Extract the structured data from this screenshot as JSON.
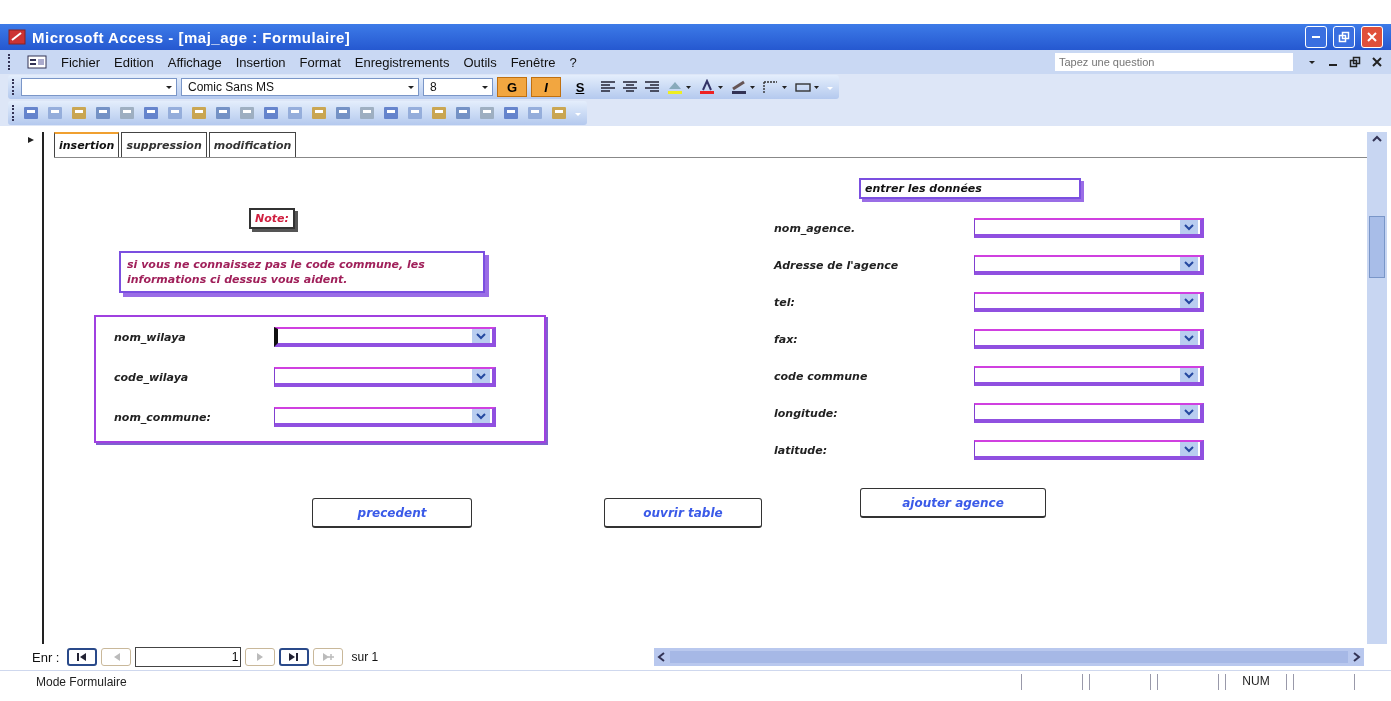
{
  "window": {
    "title": "Microsoft Access - [maj_age : Formulaire]"
  },
  "menu": [
    "Fichier",
    "Edition",
    "Affichage",
    "Insertion",
    "Format",
    "Enregistrements",
    "Outils",
    "Fenêtre",
    "?"
  ],
  "help_box": {
    "placeholder": "Tapez une question"
  },
  "format_toolbar": {
    "font": "Comic Sans MS",
    "size": "8",
    "style_buttons": [
      {
        "label": "G",
        "on": true
      },
      {
        "label": "I",
        "on": true
      },
      {
        "label": "S",
        "on": false
      }
    ]
  },
  "tabs": [
    {
      "label": "insertion",
      "selected": true
    },
    {
      "label": "suppression",
      "selected": false
    },
    {
      "label": "modification",
      "selected": false
    }
  ],
  "note": {
    "title": "Note:",
    "text": "si vous ne connaissez pas le code commune, les informations ci dessus vous aident."
  },
  "wilaya_fields": [
    {
      "label": "nom_wilaya",
      "focused": true
    },
    {
      "label": "code_wilaya",
      "focused": false
    },
    {
      "label": "nom_commune:",
      "focused": false
    }
  ],
  "section_title": "entrer les données",
  "agence_fields": [
    {
      "label": "nom_agence."
    },
    {
      "label": "Adresse de l'agence"
    },
    {
      "label": "tel:"
    },
    {
      "label": "fax:"
    },
    {
      "label": "code commune"
    },
    {
      "label": "longitude:"
    },
    {
      "label": "latitude:"
    }
  ],
  "buttons": [
    "precedent",
    "ouvrir table",
    "ajouter agence"
  ],
  "record_nav": {
    "label": "Enr :",
    "current": "1",
    "total": "sur 1",
    "buttons": [
      {
        "kind": "first",
        "disabled": false
      },
      {
        "kind": "prev",
        "disabled": true
      },
      {
        "kind": "next",
        "disabled": true
      },
      {
        "kind": "last",
        "disabled": false
      },
      {
        "kind": "new",
        "disabled": true
      }
    ]
  },
  "status_bar": {
    "mode": "Mode Formulaire",
    "indicator": "NUM"
  }
}
